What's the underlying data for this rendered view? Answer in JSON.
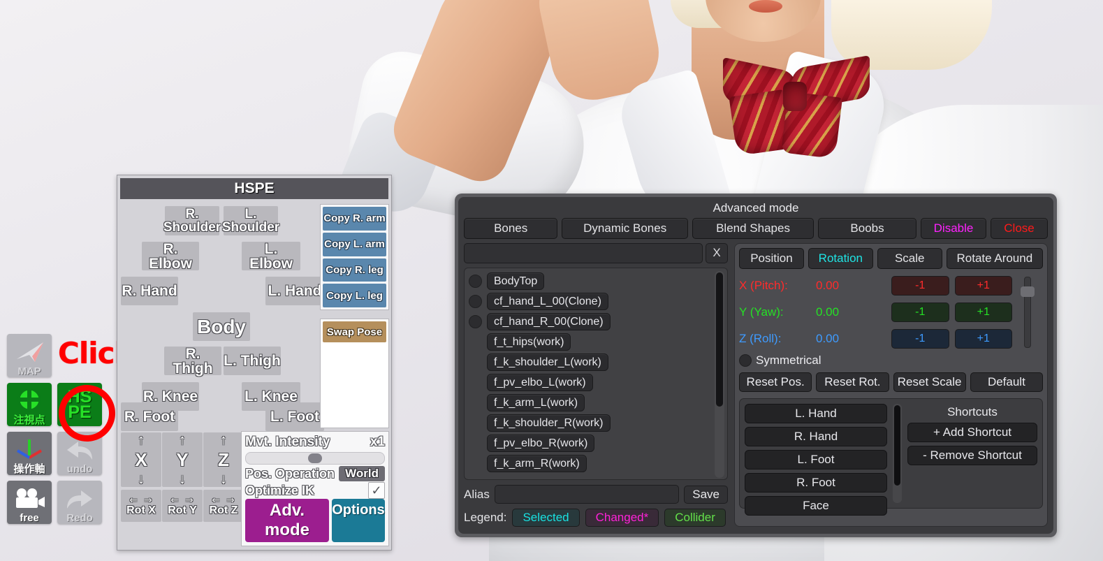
{
  "scene": {
    "description": "3D character in white school shirt with red striped bow tie, arm raised"
  },
  "sidebar": {
    "items": [
      {
        "name": "map-button",
        "caption": "MAP",
        "state": "disabled"
      },
      {
        "name": "click-annotation",
        "caption": "Click"
      },
      {
        "name": "gaze-point-button",
        "caption": "注視点",
        "state": "active"
      },
      {
        "name": "hspe-button",
        "line1": "HS",
        "line2": "PE",
        "state": "active-highlighted"
      },
      {
        "name": "axis-button",
        "caption": "操作軸",
        "state": "enabled"
      },
      {
        "name": "undo-button",
        "caption": "undo",
        "state": "disabled"
      },
      {
        "name": "camera-free-button",
        "caption": "free",
        "state": "enabled"
      },
      {
        "name": "redo-button",
        "caption": "Redo",
        "state": "disabled"
      }
    ]
  },
  "hspe": {
    "title": "HSPE",
    "body_parts": [
      {
        "label": "R.\nShoulder",
        "id": "r-shoulder"
      },
      {
        "label": "L.\nShoulder",
        "id": "l-shoulder"
      },
      {
        "label": "R. Elbow",
        "id": "r-elbow"
      },
      {
        "label": "L. Elbow",
        "id": "l-elbow"
      },
      {
        "label": "R. Hand",
        "id": "r-hand"
      },
      {
        "label": "L. Hand",
        "id": "l-hand"
      },
      {
        "label": "Body",
        "id": "body"
      },
      {
        "label": "R. Thigh",
        "id": "r-thigh"
      },
      {
        "label": "L. Thigh",
        "id": "l-thigh"
      },
      {
        "label": "R. Knee",
        "id": "r-knee"
      },
      {
        "label": "L. Knee",
        "id": "l-knee"
      },
      {
        "label": "R. Foot",
        "id": "r-foot"
      },
      {
        "label": "L. Foot",
        "id": "l-foot"
      }
    ],
    "copy_buttons": [
      "Copy R. arm",
      "Copy L. arm",
      "Copy R. leg",
      "Copy L. leg"
    ],
    "swap_pose": "Swap Pose",
    "axes": [
      {
        "letter": "X",
        "up": "↑",
        "down": "↓"
      },
      {
        "letter": "Y",
        "up": "↑",
        "down": "↓"
      },
      {
        "letter": "Z",
        "up": "↑",
        "down": "↓"
      }
    ],
    "rot_buttons": [
      {
        "label": "Rot X",
        "left": "⇐",
        "right": "⇒"
      },
      {
        "label": "Rot Y",
        "left": "⇐",
        "right": "⇒"
      },
      {
        "label": "Rot Z",
        "left": "⇐",
        "right": "⇒"
      }
    ],
    "mvt_intensity_label": "Mvt. Intensity",
    "mvt_intensity_value": "x1",
    "mvt_slider_percent": 45,
    "pos_operation_label": "Pos. Operation",
    "pos_operation_value": "World",
    "optimize_ik_label": "Optimize IK",
    "optimize_ik_checked": "✓",
    "adv_mode_button": "Adv. mode",
    "options_button": "Options"
  },
  "advanced": {
    "title": "Advanced mode",
    "tabs": [
      {
        "label": "Bones",
        "state": "active"
      },
      {
        "label": "Dynamic Bones",
        "state": "normal"
      },
      {
        "label": "Blend Shapes",
        "state": "normal"
      },
      {
        "label": "Boobs",
        "state": "normal"
      }
    ],
    "disable_label": "Disable",
    "close_label": "Close",
    "search_value": "",
    "search_clear": "X",
    "bones": [
      {
        "name": "BodyTop",
        "toggle": true
      },
      {
        "name": "cf_hand_L_00(Clone)",
        "toggle": true
      },
      {
        "name": "cf_hand_R_00(Clone)",
        "toggle": true
      },
      {
        "name": "f_t_hips(work)",
        "toggle": false
      },
      {
        "name": "f_k_shoulder_L(work)",
        "toggle": false
      },
      {
        "name": "f_pv_elbo_L(work)",
        "toggle": false
      },
      {
        "name": "f_k_arm_L(work)",
        "toggle": false
      },
      {
        "name": "f_k_shoulder_R(work)",
        "toggle": false
      },
      {
        "name": "f_pv_elbo_R(work)",
        "toggle": false
      },
      {
        "name": "f_k_arm_R(work)",
        "toggle": false
      }
    ],
    "alias_label": "Alias",
    "alias_value": "",
    "save_label": "Save",
    "legend_label": "Legend:",
    "legend": [
      {
        "label": "Selected",
        "color": "#19e2e2"
      },
      {
        "label": "Changed*",
        "color": "#ff22d8"
      },
      {
        "label": "Collider",
        "color": "#63e04a"
      }
    ],
    "mode_tabs": [
      {
        "label": "Position",
        "state": "normal"
      },
      {
        "label": "Rotation",
        "state": "active"
      },
      {
        "label": "Scale",
        "state": "normal"
      },
      {
        "label": "Rotate Around",
        "state": "normal"
      }
    ],
    "rotation_rows": [
      {
        "label": "X (Pitch):",
        "value": "0.00",
        "minus": "-1",
        "plus": "+1",
        "color": "#ff2b2b"
      },
      {
        "label": "Y (Yaw):",
        "value": "0.00",
        "minus": "-1",
        "plus": "+1",
        "color": "#25e025"
      },
      {
        "label": "Z (Roll):",
        "value": "0.00",
        "minus": "-1",
        "plus": "+1",
        "color": "#3e9bff"
      }
    ],
    "symmetrical_label": "Symmetrical",
    "symmetrical_checked": false,
    "reset_buttons": [
      "Reset Pos.",
      "Reset Rot.",
      "Reset Scale",
      "Default"
    ],
    "shortcut_list": [
      "L. Hand",
      "R. Hand",
      "L. Foot",
      "R. Foot",
      "Face"
    ],
    "shortcuts_title": "Shortcuts",
    "add_shortcut": "+ Add Shortcut",
    "remove_shortcut": "- Remove Shortcut"
  }
}
